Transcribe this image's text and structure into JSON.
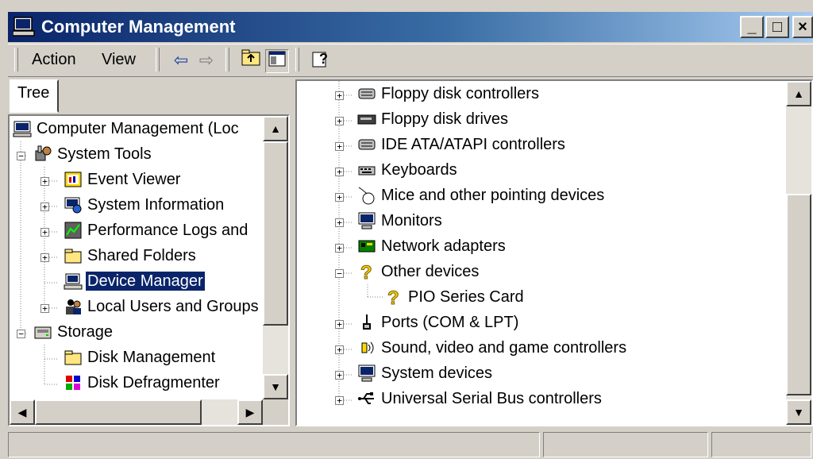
{
  "window": {
    "title": "Computer Management",
    "min_label": "_",
    "max_label": "□",
    "close_label": "×"
  },
  "toolbar": {
    "menu": [
      {
        "label": "Action"
      },
      {
        "label": "View"
      }
    ],
    "icons": [
      "back-arrow-icon",
      "forward-arrow-icon",
      "up-folder-icon",
      "show-hide-tree-icon",
      "help-icon"
    ]
  },
  "tree": {
    "tab_label": "Tree",
    "items": [
      {
        "label": "Computer Management (Loc",
        "icon": "computer-icon",
        "level": 0
      },
      {
        "label": "System Tools",
        "icon": "system-tools-icon",
        "level": 1,
        "expander": "−"
      },
      {
        "label": "Event Viewer",
        "icon": "event-viewer-icon",
        "level": 2,
        "expander": "+"
      },
      {
        "label": "System Information",
        "icon": "system-information-icon",
        "level": 2,
        "expander": "+"
      },
      {
        "label": "Performance Logs and",
        "icon": "performance-icon",
        "level": 2,
        "expander": "+"
      },
      {
        "label": "Shared Folders",
        "icon": "folder-icon",
        "level": 2,
        "expander": "+"
      },
      {
        "label": "Device Manager",
        "icon": "device-manager-icon",
        "level": 2,
        "selected": true
      },
      {
        "label": "Local Users and Groups",
        "icon": "users-icon",
        "level": 2,
        "expander": "+"
      },
      {
        "label": "Storage",
        "icon": "storage-icon",
        "level": 1,
        "expander": "−"
      },
      {
        "label": "Disk Management",
        "icon": "folder-icon",
        "level": 2
      },
      {
        "label": "Disk Defragmenter",
        "icon": "defragmenter-icon",
        "level": 2
      }
    ]
  },
  "devices": {
    "items": [
      {
        "label": "Floppy disk controllers",
        "icon": "controller-icon",
        "expander": "+"
      },
      {
        "label": "Floppy disk drives",
        "icon": "floppy-drive-icon",
        "expander": "+"
      },
      {
        "label": "IDE ATA/ATAPI controllers",
        "icon": "controller-icon",
        "expander": "+"
      },
      {
        "label": "Keyboards",
        "icon": "keyboard-icon",
        "expander": "+"
      },
      {
        "label": "Mice and other pointing devices",
        "icon": "mouse-icon",
        "expander": "+"
      },
      {
        "label": "Monitors",
        "icon": "monitor-icon",
        "expander": "+"
      },
      {
        "label": "Network adapters",
        "icon": "network-adapter-icon",
        "expander": "+"
      },
      {
        "label": "Other devices",
        "icon": "question-icon",
        "expander": "−"
      },
      {
        "label": "PIO Series Card",
        "icon": "question-icon",
        "child": true
      },
      {
        "label": "Ports (COM & LPT)",
        "icon": "port-icon",
        "expander": "+"
      },
      {
        "label": "Sound, video and game controllers",
        "icon": "speaker-icon",
        "expander": "+"
      },
      {
        "label": "System devices",
        "icon": "monitor-icon",
        "expander": "+"
      },
      {
        "label": "Universal Serial Bus controllers",
        "icon": "usb-icon",
        "expander": "+"
      }
    ]
  },
  "scroll": {
    "up": "▲",
    "down": "▼",
    "left": "◀",
    "right": "▶"
  },
  "colors": {
    "titlebar_start": "#0a246a",
    "titlebar_end": "#a6caf0",
    "face": "#d4d0c8",
    "selection": "#0a246a"
  }
}
